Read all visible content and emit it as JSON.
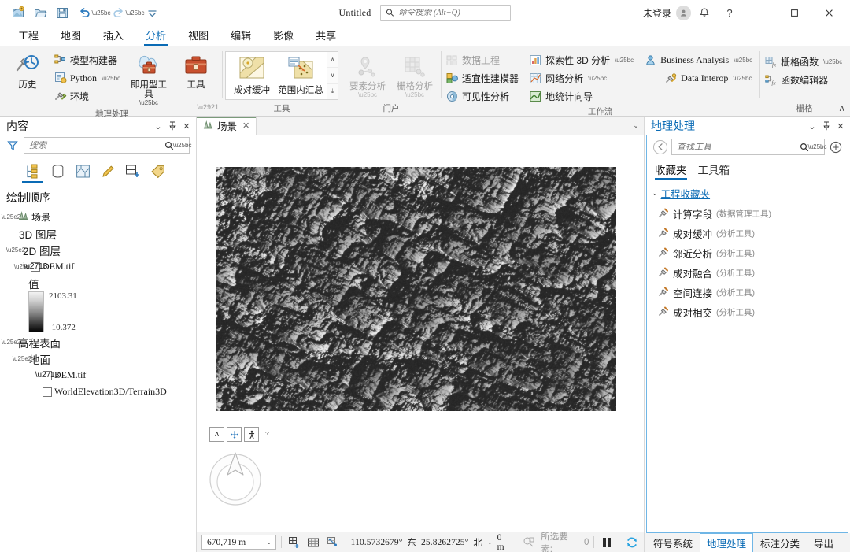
{
  "titlebar": {
    "doc_title": "Untitled",
    "search_placeholder": "命令搜索 (Alt+Q)",
    "signin_label": "未登录",
    "quick_access": [
      {
        "name": "new-project-icon",
        "title": "新建工程"
      },
      {
        "name": "open-project-icon",
        "title": "打开工程"
      },
      {
        "name": "save-project-icon",
        "title": "保存工程"
      },
      {
        "name": "undo-icon",
        "title": "撤销"
      },
      {
        "name": "redo-icon",
        "title": "重做"
      },
      {
        "name": "customize-quick-access-icon",
        "title": "自定义快速访问工具栏"
      }
    ],
    "window_buttons": {
      "minimize": "─",
      "maximize": "☐",
      "close": "✕"
    },
    "help_glyph": "?",
    "notifications_glyph": "⚇",
    "avatar_glyph": "⚹"
  },
  "ribbon_tabs": [
    {
      "label": "工程",
      "active": false
    },
    {
      "label": "地图",
      "active": false
    },
    {
      "label": "插入",
      "active": false
    },
    {
      "label": "分析",
      "active": true
    },
    {
      "label": "视图",
      "active": false
    },
    {
      "label": "编辑",
      "active": false
    },
    {
      "label": "影像",
      "active": false
    },
    {
      "label": "共享",
      "active": false
    }
  ],
  "ribbon": {
    "groups": [
      {
        "title": "地理处理",
        "has_dialog_launcher": true,
        "big_buttons": [
          {
            "label": "历史",
            "icon": "history-clock-icon",
            "caret": false
          },
          {
            "label": "即用型工具",
            "icon": "ready-to-use-tools-icon",
            "caret": true
          },
          {
            "label": "工具",
            "icon": "toolbox-icon",
            "caret": false
          }
        ],
        "small_buttons": [
          {
            "label": "模型构建器",
            "icon": "model-builder-icon",
            "caret": false
          },
          {
            "label": "Python",
            "icon": "python-icon",
            "caret": true,
            "mono": true
          },
          {
            "label": "环境",
            "icon": "environments-icon",
            "caret": false
          }
        ]
      },
      {
        "title": "工具",
        "gallery": [
          {
            "label": "成对缓冲",
            "icon": "pairwise-buffer-icon"
          },
          {
            "label": "范围内汇总",
            "icon": "summarize-within-icon"
          }
        ],
        "scroll_glyphs": [
          "∧",
          "∨",
          "⤓"
        ]
      },
      {
        "title": "门户",
        "big_buttons": [
          {
            "label": "要素分析",
            "icon": "feature-analysis-icon",
            "caret": true,
            "disabled": true
          },
          {
            "label": "栅格分析",
            "icon": "raster-analysis-icon",
            "caret": true,
            "disabled": true
          }
        ]
      },
      {
        "title": "工作流",
        "columns": [
          [
            {
              "label": "数据工程",
              "icon": "data-engineering-icon",
              "disabled": true
            },
            {
              "label": "适宜性建模器",
              "icon": "suitability-modeler-icon"
            },
            {
              "label": "可见性分析",
              "icon": "visibility-analysis-icon"
            }
          ],
          [
            {
              "label": "探索性 3D 分析",
              "icon": "exploratory-3d-analysis-icon",
              "caret": true
            },
            {
              "label": "网络分析",
              "icon": "network-analysis-icon",
              "caret": true
            },
            {
              "label": "地统计向导",
              "icon": "geostatistical-wizard-icon"
            }
          ],
          [
            {
              "label": "Business Analysis",
              "icon": "business-analysis-icon",
              "caret": true,
              "mono": true
            },
            {
              "label": "Data Interop",
              "icon": "data-interop-icon",
              "caret": true,
              "mono": true
            }
          ]
        ]
      },
      {
        "title": "栅格",
        "columns": [
          [
            {
              "label": "栅格函数",
              "icon": "raster-functions-icon",
              "caret": true
            },
            {
              "label": "函数编辑器",
              "icon": "function-editor-icon"
            }
          ]
        ]
      }
    ],
    "collapse_glyph": "∧"
  },
  "contents_pane": {
    "title": "内容",
    "search_placeholder": "搜索",
    "header_buttons": [
      {
        "name": "pane-menu-icon",
        "glyph": "⌄"
      },
      {
        "name": "pin-icon",
        "glyph": "⍑"
      },
      {
        "name": "close-icon",
        "glyph": "✕"
      }
    ],
    "tabs": [
      {
        "name": "drawing-order-tab",
        "icon": "drawing-order-icon",
        "active": true
      },
      {
        "name": "data-source-tab",
        "icon": "database-icon",
        "active": false
      },
      {
        "name": "selection-tab",
        "icon": "selection-map-icon",
        "active": false
      },
      {
        "name": "editing-tab",
        "icon": "pencil-icon",
        "active": false
      },
      {
        "name": "snapping-tab",
        "icon": "grid-plus-icon",
        "active": false
      },
      {
        "name": "labeling-tab",
        "icon": "label-tag-icon",
        "active": false
      }
    ],
    "heading": "绘制顺序",
    "tree": [
      {
        "label": "场景",
        "type": "scene",
        "indent": 0,
        "arrow": "◢",
        "icon": "scene-icon"
      },
      {
        "label": "3D 图层",
        "type": "group",
        "indent": 1,
        "arrow": ""
      },
      {
        "label": "2D 图层",
        "type": "group",
        "indent": 1,
        "arrow": "◢"
      },
      {
        "label": "DEM.tif",
        "type": "layer",
        "indent": 2,
        "arrow": "◢",
        "checked": true
      },
      {
        "label": "值",
        "type": "symbology-header",
        "indent": 3
      },
      {
        "label": "高程表面",
        "type": "group",
        "indent": 0,
        "arrow": "◢"
      },
      {
        "label": "地面",
        "type": "group",
        "indent": 1,
        "arrow": "◢"
      },
      {
        "label": "DEM.tif",
        "type": "layer",
        "indent": 2,
        "checked": true
      },
      {
        "label": "WorldElevation3D/Terrain3D",
        "type": "layer",
        "indent": 2,
        "checked": false
      }
    ],
    "ramp": {
      "max": "2103.31",
      "min": "-10.372"
    }
  },
  "view": {
    "tabs": [
      {
        "label": "场景",
        "icon": "scene-icon",
        "close": "✕",
        "active": true
      }
    ],
    "overflow_caret": "⌄",
    "map_nav_buttons": [
      {
        "name": "map-nav-up-button",
        "glyph": "∧"
      },
      {
        "name": "map-nav-pan-button",
        "glyph": "✥"
      },
      {
        "name": "map-nav-walk-button",
        "glyph": "↯"
      }
    ],
    "map_nav_dots": "⁙",
    "navigator_name": "navigator-compass"
  },
  "statusbar": {
    "scale": "670,719 m",
    "scale_caret": "⌄",
    "icons": [
      {
        "name": "select-features-icon",
        "glyph": "⊞"
      },
      {
        "name": "grid-icon",
        "glyph": "▦"
      },
      {
        "name": "measure-icon",
        "glyph": "⌗"
      }
    ],
    "longitude": "110.5732679°",
    "longitude_dir": "东",
    "latitude": "25.8262725°",
    "latitude_dir": "北",
    "coord_caret": "⌄",
    "elevation": "0 m",
    "selected_label": "所选要素:",
    "selected_count": "0",
    "pause_name": "pause-drawing-button",
    "refresh_name": "refresh-button",
    "refresh_glyph": "↻"
  },
  "gp_pane": {
    "title": "地理处理",
    "search_placeholder": "查找工具",
    "header_buttons": [
      {
        "name": "pane-menu-icon",
        "glyph": "⌄"
      },
      {
        "name": "pin-icon",
        "glyph": "⍑"
      },
      {
        "name": "close-icon",
        "glyph": "✕"
      }
    ],
    "back_glyph": "←",
    "add_glyph": "⊕",
    "tabs": [
      {
        "label": "收藏夹",
        "active": true
      },
      {
        "label": "工具箱",
        "active": false
      }
    ],
    "group_label": "工程收藏夹",
    "group_arrow": "⌄",
    "tools": [
      {
        "name": "计算字段",
        "toolbox": "(数据管理工具)"
      },
      {
        "name": "成对缓冲",
        "toolbox": "(分析工具)"
      },
      {
        "name": "邻近分析",
        "toolbox": "(分析工具)"
      },
      {
        "name": "成对融合",
        "toolbox": "(分析工具)"
      },
      {
        "name": "空间连接",
        "toolbox": "(分析工具)"
      },
      {
        "name": "成对相交",
        "toolbox": "(分析工具)"
      }
    ]
  },
  "bottom_tabs": [
    {
      "label": "符号系统",
      "active": false
    },
    {
      "label": "地理处理",
      "active": true
    },
    {
      "label": "标注分类",
      "active": false
    },
    {
      "label": "导出",
      "active": false
    }
  ],
  "colors": {
    "accent": "#0a6bb5",
    "pane_border": "#6fb6e6",
    "ribbon_bg": "#f3f3f3"
  }
}
